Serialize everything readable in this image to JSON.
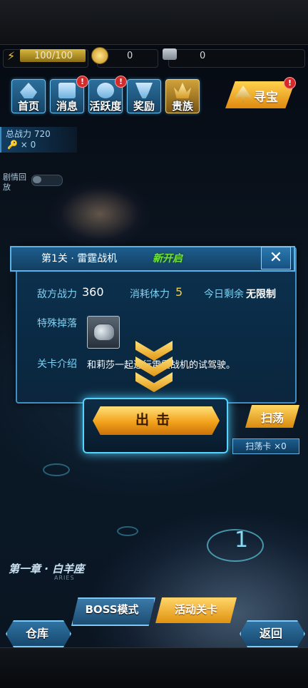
{
  "resources": {
    "energy": "100/100",
    "energy_fraction": 1.0,
    "gold": "0",
    "gems": "0"
  },
  "nav": [
    {
      "label": "首页",
      "badge": ""
    },
    {
      "label": "消息",
      "badge": "!"
    },
    {
      "label": "活跃度",
      "badge": "!"
    },
    {
      "label": "奖励",
      "badge": ""
    },
    {
      "label": "贵族",
      "badge": ""
    }
  ],
  "treasure": {
    "label": "寻宝",
    "badge": "!"
  },
  "power_panel": {
    "label": "总战力",
    "value": "720",
    "key_count": "× 0"
  },
  "plot_toggle": {
    "label": "剧情回放"
  },
  "dialog": {
    "title": "第1关 · 雷霆战机",
    "status": "新开启",
    "close": "✕",
    "enemy_power_label": "敌方战力",
    "enemy_power": "360",
    "stamina_label": "消耗体力",
    "stamina": "5",
    "remaining_label": "今日剩余",
    "remaining": "无限制",
    "drop_label": "特殊掉落",
    "intro_label": "关卡介绍",
    "intro_text": "和莉莎一起进行雷霆战机的试驾驶。"
  },
  "attack": {
    "label": "出击"
  },
  "sweep": {
    "label": "扫荡",
    "card_label": "扫荡卡",
    "card_count": "×0"
  },
  "map": {
    "chapter": "第一章 · 白羊座",
    "chapter_sub": "ARIES",
    "stage_number": "1"
  },
  "bottom": {
    "boss_mode": "BOSS模式",
    "event_stage": "活动关卡",
    "warehouse": "仓库",
    "back": "返回"
  },
  "colors": {
    "accent_blue": "#3f8fc6",
    "accent_gold": "#f2a21b",
    "new_green": "#6fe23c",
    "label_cyan": "#7dd0f2",
    "stamina_yellow": "#f2cf42"
  }
}
